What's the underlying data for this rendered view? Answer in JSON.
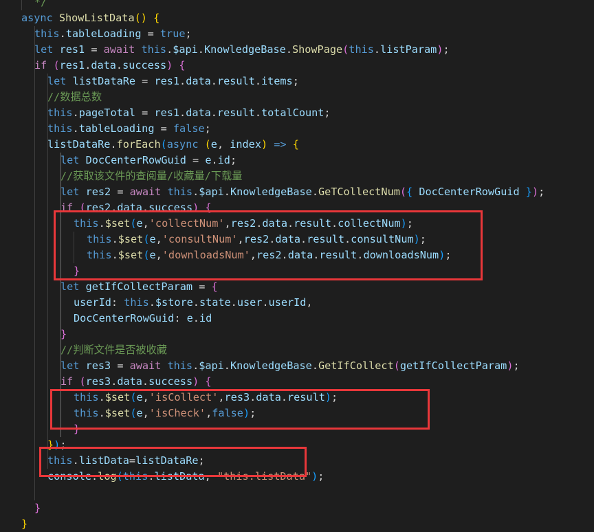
{
  "editor": {
    "theme": "dark",
    "background": "#1e1e1e",
    "highlight_color": "#e8373a",
    "lines": [
      [
        [
          "*/",
          "cm"
        ]
      ],
      [
        [
          "async",
          "kw"
        ],
        [
          " ",
          "pl"
        ],
        [
          "ShowListData",
          "fn"
        ],
        [
          "()",
          "br1"
        ],
        [
          " ",
          "pl"
        ],
        [
          "{",
          "br1"
        ]
      ],
      [
        [
          "this",
          "kw"
        ],
        [
          ".",
          "pl"
        ],
        [
          "tableLoading",
          "var"
        ],
        [
          " = ",
          "pl"
        ],
        [
          "true",
          "kw"
        ],
        [
          ";",
          "pl"
        ]
      ],
      [
        [
          "let",
          "kw"
        ],
        [
          " ",
          "pl"
        ],
        [
          "res1",
          "var"
        ],
        [
          " = ",
          "pl"
        ],
        [
          "await",
          "ctl"
        ],
        [
          " ",
          "pl"
        ],
        [
          "this",
          "kw"
        ],
        [
          ".",
          "pl"
        ],
        [
          "$api",
          "var"
        ],
        [
          ".",
          "pl"
        ],
        [
          "KnowledgeBase",
          "var"
        ],
        [
          ".",
          "pl"
        ],
        [
          "ShowPage",
          "fn"
        ],
        [
          "(",
          "br2"
        ],
        [
          "this",
          "kw"
        ],
        [
          ".",
          "pl"
        ],
        [
          "listParam",
          "var"
        ],
        [
          ")",
          "br2"
        ],
        [
          ";",
          "pl"
        ]
      ],
      [
        [
          "if",
          "ctl"
        ],
        [
          " ",
          "pl"
        ],
        [
          "(",
          "br2"
        ],
        [
          "res1",
          "var"
        ],
        [
          ".",
          "pl"
        ],
        [
          "data",
          "var"
        ],
        [
          ".",
          "pl"
        ],
        [
          "success",
          "var"
        ],
        [
          ")",
          "br2"
        ],
        [
          " ",
          "pl"
        ],
        [
          "{",
          "br2"
        ]
      ],
      [
        [
          "let",
          "kw"
        ],
        [
          " ",
          "pl"
        ],
        [
          "listDataRe",
          "var"
        ],
        [
          " = ",
          "pl"
        ],
        [
          "res1",
          "var"
        ],
        [
          ".",
          "pl"
        ],
        [
          "data",
          "var"
        ],
        [
          ".",
          "pl"
        ],
        [
          "result",
          "var"
        ],
        [
          ".",
          "pl"
        ],
        [
          "items",
          "var"
        ],
        [
          ";",
          "pl"
        ]
      ],
      [
        [
          "//数据总数",
          "cm"
        ]
      ],
      [
        [
          "this",
          "kw"
        ],
        [
          ".",
          "pl"
        ],
        [
          "pageTotal",
          "var"
        ],
        [
          " = ",
          "pl"
        ],
        [
          "res1",
          "var"
        ],
        [
          ".",
          "pl"
        ],
        [
          "data",
          "var"
        ],
        [
          ".",
          "pl"
        ],
        [
          "result",
          "var"
        ],
        [
          ".",
          "pl"
        ],
        [
          "totalCount",
          "var"
        ],
        [
          ";",
          "pl"
        ]
      ],
      [
        [
          "this",
          "kw"
        ],
        [
          ".",
          "pl"
        ],
        [
          "tableLoading",
          "var"
        ],
        [
          " = ",
          "pl"
        ],
        [
          "false",
          "kw"
        ],
        [
          ";",
          "pl"
        ]
      ],
      [
        [
          "listDataRe",
          "var"
        ],
        [
          ".",
          "pl"
        ],
        [
          "forEach",
          "fn"
        ],
        [
          "(",
          "br3"
        ],
        [
          "async",
          "kw"
        ],
        [
          " ",
          "pl"
        ],
        [
          "(",
          "br1"
        ],
        [
          "e",
          "var"
        ],
        [
          ", ",
          "pl"
        ],
        [
          "index",
          "var"
        ],
        [
          ")",
          "br1"
        ],
        [
          " ",
          "pl"
        ],
        [
          "=>",
          "kw"
        ],
        [
          " ",
          "pl"
        ],
        [
          "{",
          "br1"
        ]
      ],
      [
        [
          "let",
          "kw"
        ],
        [
          " ",
          "pl"
        ],
        [
          "DocCenterRowGuid",
          "var"
        ],
        [
          " = ",
          "pl"
        ],
        [
          "e",
          "var"
        ],
        [
          ".",
          "pl"
        ],
        [
          "id",
          "var"
        ],
        [
          ";",
          "pl"
        ]
      ],
      [
        [
          "//获取该文件的查阅量/收藏量/下载量",
          "cm"
        ]
      ],
      [
        [
          "let",
          "kw"
        ],
        [
          " ",
          "pl"
        ],
        [
          "res2",
          "var"
        ],
        [
          " = ",
          "pl"
        ],
        [
          "await",
          "ctl"
        ],
        [
          " ",
          "pl"
        ],
        [
          "this",
          "kw"
        ],
        [
          ".",
          "pl"
        ],
        [
          "$api",
          "var"
        ],
        [
          ".",
          "pl"
        ],
        [
          "KnowledgeBase",
          "var"
        ],
        [
          ".",
          "pl"
        ],
        [
          "GeTCollectNum",
          "fn"
        ],
        [
          "(",
          "br2"
        ],
        [
          "{",
          "br3"
        ],
        [
          " ",
          "pl"
        ],
        [
          "DocCenterRowGuid",
          "var"
        ],
        [
          " ",
          "pl"
        ],
        [
          "}",
          "br3"
        ],
        [
          ")",
          "br2"
        ],
        [
          ";",
          "pl"
        ]
      ],
      [
        [
          "if",
          "ctl"
        ],
        [
          " ",
          "pl"
        ],
        [
          "(",
          "br2"
        ],
        [
          "res2",
          "var"
        ],
        [
          ".",
          "pl"
        ],
        [
          "data",
          "var"
        ],
        [
          ".",
          "pl"
        ],
        [
          "success",
          "var"
        ],
        [
          ")",
          "br2"
        ],
        [
          " ",
          "pl"
        ],
        [
          "{",
          "br2"
        ]
      ],
      [
        [
          "this",
          "kw"
        ],
        [
          ".",
          "pl"
        ],
        [
          "$set",
          "fn"
        ],
        [
          "(",
          "br3"
        ],
        [
          "e",
          "var"
        ],
        [
          ",",
          "pl"
        ],
        [
          "'collectNum'",
          "str"
        ],
        [
          ",",
          "pl"
        ],
        [
          "res2",
          "var"
        ],
        [
          ".",
          "pl"
        ],
        [
          "data",
          "var"
        ],
        [
          ".",
          "pl"
        ],
        [
          "result",
          "var"
        ],
        [
          ".",
          "pl"
        ],
        [
          "collectNum",
          "var"
        ],
        [
          ")",
          "br3"
        ],
        [
          ";",
          "pl"
        ]
      ],
      [
        [
          "this",
          "kw"
        ],
        [
          ".",
          "pl"
        ],
        [
          "$set",
          "fn"
        ],
        [
          "(",
          "br3"
        ],
        [
          "e",
          "var"
        ],
        [
          ",",
          "pl"
        ],
        [
          "'consultNum'",
          "str"
        ],
        [
          ",",
          "pl"
        ],
        [
          "res2",
          "var"
        ],
        [
          ".",
          "pl"
        ],
        [
          "data",
          "var"
        ],
        [
          ".",
          "pl"
        ],
        [
          "result",
          "var"
        ],
        [
          ".",
          "pl"
        ],
        [
          "consultNum",
          "var"
        ],
        [
          ")",
          "br3"
        ],
        [
          ";",
          "pl"
        ]
      ],
      [
        [
          "this",
          "kw"
        ],
        [
          ".",
          "pl"
        ],
        [
          "$set",
          "fn"
        ],
        [
          "(",
          "br3"
        ],
        [
          "e",
          "var"
        ],
        [
          ",",
          "pl"
        ],
        [
          "'downloadsNum'",
          "str"
        ],
        [
          ",",
          "pl"
        ],
        [
          "res2",
          "var"
        ],
        [
          ".",
          "pl"
        ],
        [
          "data",
          "var"
        ],
        [
          ".",
          "pl"
        ],
        [
          "result",
          "var"
        ],
        [
          ".",
          "pl"
        ],
        [
          "downloadsNum",
          "var"
        ],
        [
          ")",
          "br3"
        ],
        [
          ";",
          "pl"
        ]
      ],
      [
        [
          "}",
          "br2"
        ]
      ],
      [
        [
          "let",
          "kw"
        ],
        [
          " ",
          "pl"
        ],
        [
          "getIfCollectParam",
          "var"
        ],
        [
          " = ",
          "pl"
        ],
        [
          "{",
          "br2"
        ]
      ],
      [
        [
          "userId",
          "var"
        ],
        [
          ": ",
          "pl"
        ],
        [
          "this",
          "kw"
        ],
        [
          ".",
          "pl"
        ],
        [
          "$store",
          "var"
        ],
        [
          ".",
          "pl"
        ],
        [
          "state",
          "var"
        ],
        [
          ".",
          "pl"
        ],
        [
          "user",
          "var"
        ],
        [
          ".",
          "pl"
        ],
        [
          "userId",
          "var"
        ],
        [
          ",",
          "pl"
        ]
      ],
      [
        [
          "DocCenterRowGuid",
          "var"
        ],
        [
          ": ",
          "pl"
        ],
        [
          "e",
          "var"
        ],
        [
          ".",
          "pl"
        ],
        [
          "id",
          "var"
        ]
      ],
      [
        [
          "}",
          "br2"
        ]
      ],
      [
        [
          "//判断文件是否被收藏",
          "cm"
        ]
      ],
      [
        [
          "let",
          "kw"
        ],
        [
          " ",
          "pl"
        ],
        [
          "res3",
          "var"
        ],
        [
          " = ",
          "pl"
        ],
        [
          "await",
          "ctl"
        ],
        [
          " ",
          "pl"
        ],
        [
          "this",
          "kw"
        ],
        [
          ".",
          "pl"
        ],
        [
          "$api",
          "var"
        ],
        [
          ".",
          "pl"
        ],
        [
          "KnowledgeBase",
          "var"
        ],
        [
          ".",
          "pl"
        ],
        [
          "GetIfCollect",
          "fn"
        ],
        [
          "(",
          "br2"
        ],
        [
          "getIfCollectParam",
          "var"
        ],
        [
          ")",
          "br2"
        ],
        [
          ";",
          "pl"
        ]
      ],
      [
        [
          "if",
          "ctl"
        ],
        [
          " ",
          "pl"
        ],
        [
          "(",
          "br2"
        ],
        [
          "res3",
          "var"
        ],
        [
          ".",
          "pl"
        ],
        [
          "data",
          "var"
        ],
        [
          ".",
          "pl"
        ],
        [
          "success",
          "var"
        ],
        [
          ")",
          "br2"
        ],
        [
          " ",
          "pl"
        ],
        [
          "{",
          "br2"
        ]
      ],
      [
        [
          "this",
          "kw"
        ],
        [
          ".",
          "pl"
        ],
        [
          "$set",
          "fn"
        ],
        [
          "(",
          "br3"
        ],
        [
          "e",
          "var"
        ],
        [
          ",",
          "pl"
        ],
        [
          "'isCollect'",
          "str"
        ],
        [
          ",",
          "pl"
        ],
        [
          "res3",
          "var"
        ],
        [
          ".",
          "pl"
        ],
        [
          "data",
          "var"
        ],
        [
          ".",
          "pl"
        ],
        [
          "result",
          "var"
        ],
        [
          ")",
          "br3"
        ],
        [
          ";",
          "pl"
        ]
      ],
      [
        [
          "this",
          "kw"
        ],
        [
          ".",
          "pl"
        ],
        [
          "$set",
          "fn"
        ],
        [
          "(",
          "br3"
        ],
        [
          "e",
          "var"
        ],
        [
          ",",
          "pl"
        ],
        [
          "'isCheck'",
          "str"
        ],
        [
          ",",
          "pl"
        ],
        [
          "false",
          "kw"
        ],
        [
          ")",
          "br3"
        ],
        [
          ";",
          "pl"
        ]
      ],
      [
        [
          "}",
          "br2"
        ]
      ],
      [
        [
          "}",
          "br1"
        ],
        [
          ")",
          "br3"
        ],
        [
          ";",
          "pl"
        ]
      ],
      [
        [
          "this",
          "kw"
        ],
        [
          ".",
          "pl"
        ],
        [
          "listData",
          "var"
        ],
        [
          "=",
          "pl"
        ],
        [
          "listDataRe",
          "var"
        ],
        [
          ";",
          "pl"
        ]
      ],
      [
        [
          "console",
          "var"
        ],
        [
          ".",
          "pl"
        ],
        [
          "log",
          "fn"
        ],
        [
          "(",
          "br3"
        ],
        [
          "this",
          "kw"
        ],
        [
          ".",
          "pl"
        ],
        [
          "listData",
          "var"
        ],
        [
          ", ",
          "pl"
        ],
        [
          "\"this.listData\"",
          "str"
        ],
        [
          ")",
          "br3"
        ],
        [
          ";",
          "pl"
        ]
      ],
      [],
      [
        [
          "}",
          "br2"
        ]
      ],
      [
        [
          "}",
          "br1"
        ]
      ]
    ]
  }
}
